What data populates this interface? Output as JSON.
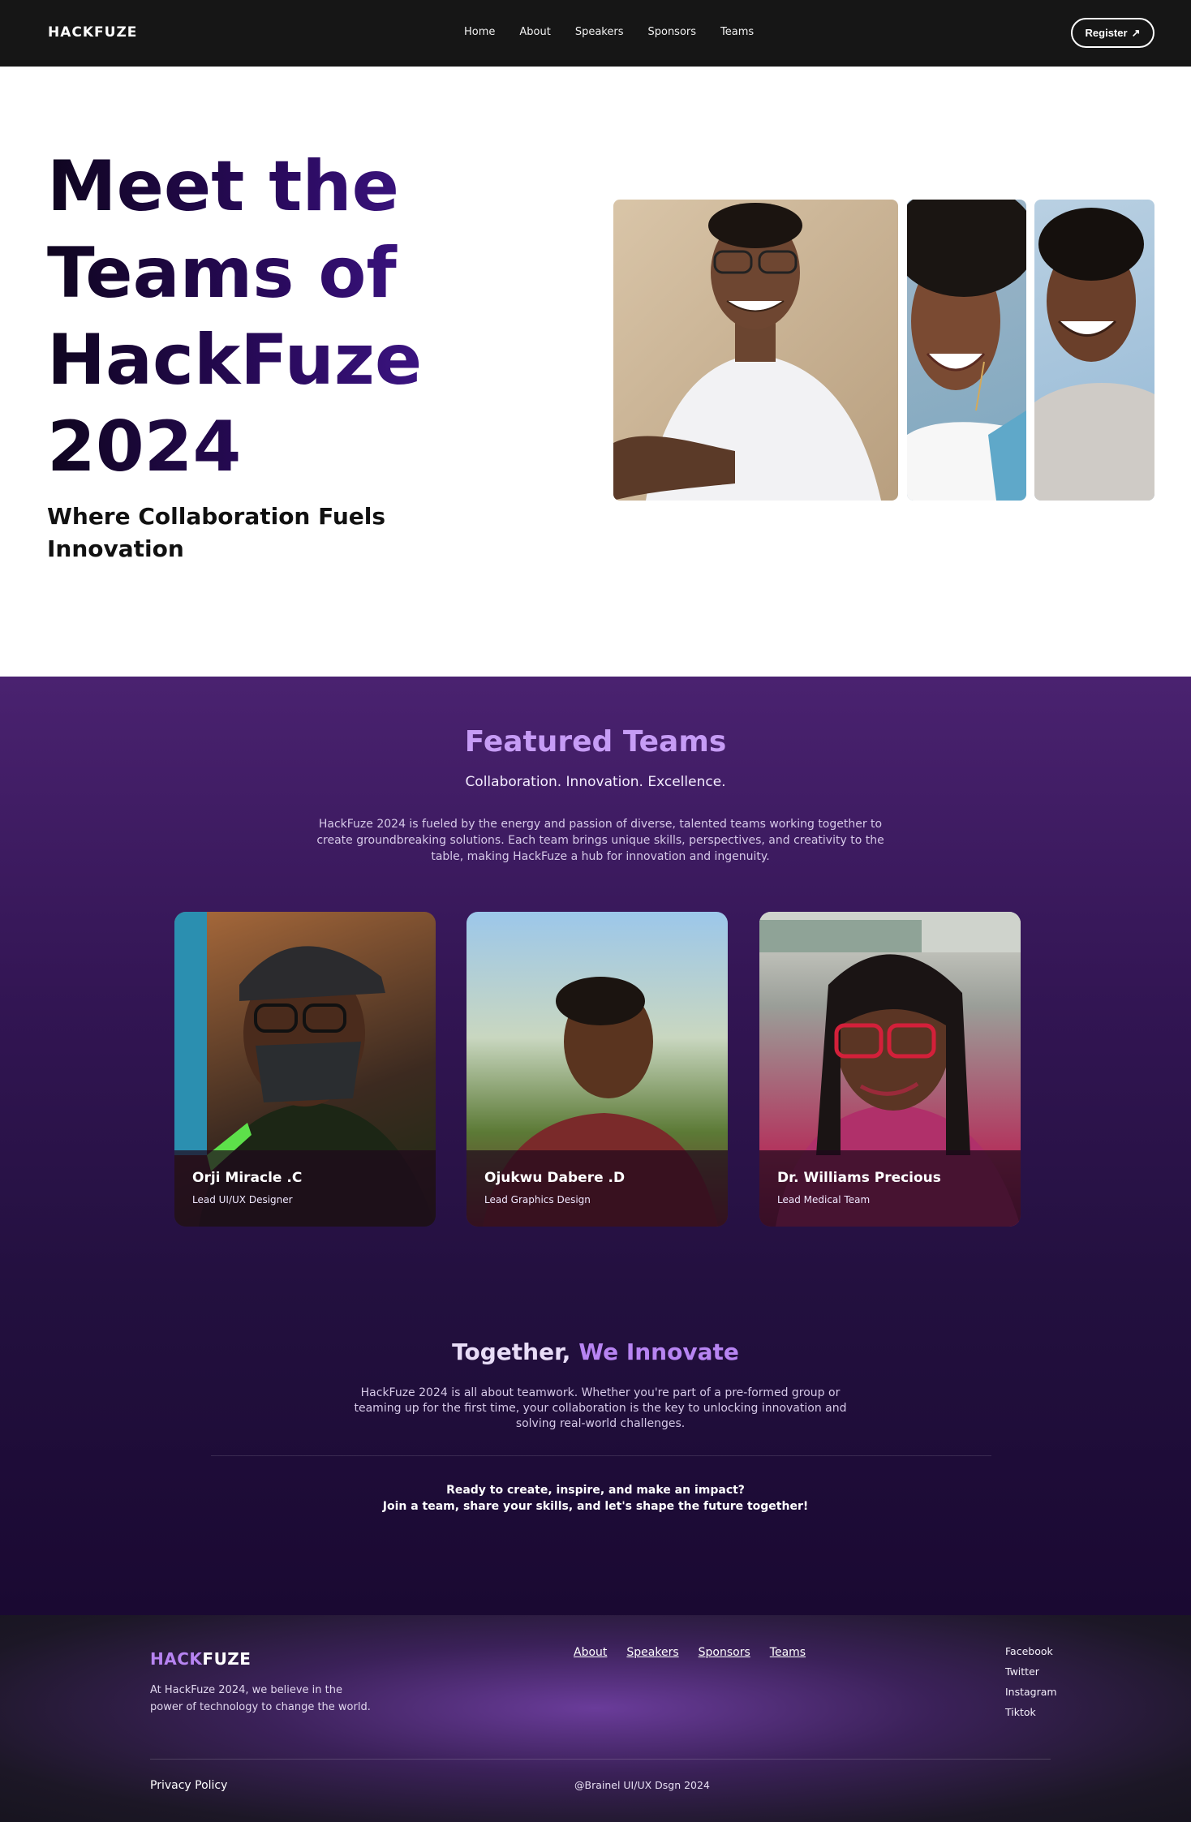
{
  "nav": {
    "logo": "HACKFUZE",
    "links": [
      "Home",
      "About",
      "Speakers",
      "Sponsors",
      "Teams"
    ],
    "register_label": "Register",
    "register_icon": "arrow-up-right-icon"
  },
  "hero": {
    "title": "Meet the Teams of HackFuze 2024",
    "subtitle": "Where Collaboration Fuels Innovation"
  },
  "featured": {
    "title": "Featured Teams",
    "tagline": "Collaboration. Innovation. Excellence.",
    "description": "HackFuze 2024 is fueled by the energy and passion of diverse, talented teams working together to create groundbreaking solutions. Each team brings unique skills, perspectives, and creativity to the table, making HackFuze a hub for innovation and ingenuity.",
    "cards": [
      {
        "name": "Orji Miracle .C",
        "role": "Lead UI/UX Designer"
      },
      {
        "name": "Ojukwu Dabere .D",
        "role": "Lead Graphics Design"
      },
      {
        "name": "Dr. Williams Precious",
        "role": "Lead Medical Team"
      }
    ]
  },
  "together": {
    "title_part1": "Together, ",
    "title_part2": "We Innovate",
    "description": "HackFuze 2024 is all about teamwork. Whether you're part of a pre-formed group or teaming up for the first time, your collaboration is the key to unlocking innovation and solving real-world challenges.",
    "cta_line1": "Ready to create, inspire, and make an impact?",
    "cta_line2": "Join a team, share your skills, and let's shape the future together!"
  },
  "footer": {
    "logo_part1": "HACK",
    "logo_part2": "FUZE",
    "about": "At HackFuze 2024, we believe in the power of technology to change the world.",
    "links": [
      "About",
      "Speakers",
      "Sponsors",
      "Teams"
    ],
    "social": [
      "Facebook",
      "Twitter",
      "Instagram",
      "Tiktok"
    ],
    "privacy": "Privacy Policy",
    "copyright": "@Brainel UI/UX Dsgn 2024"
  },
  "colors": {
    "nav_bg": "#161616",
    "accent_purple": "#b784f2",
    "featured_bg": "#321553",
    "hero_title": "#2a0a5e"
  }
}
